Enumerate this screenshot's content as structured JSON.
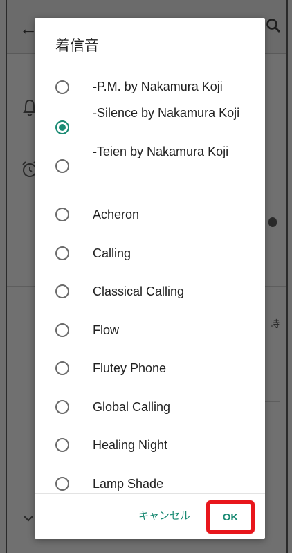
{
  "dialog": {
    "title": "着信音",
    "options": [
      {
        "label": "-P.M. by Nakamura Koji",
        "selected": false
      },
      {
        "label": "-Silence by Nakamura Koji",
        "selected": true
      },
      {
        "label": "-Teien by Nakamura Koji",
        "selected": false
      },
      {
        "label": "Acheron",
        "selected": false
      },
      {
        "label": "Calling",
        "selected": false
      },
      {
        "label": "Classical Calling",
        "selected": false
      },
      {
        "label": "Flow",
        "selected": false
      },
      {
        "label": "Flutey Phone",
        "selected": false
      },
      {
        "label": "Global Calling",
        "selected": false
      },
      {
        "label": "Healing Night",
        "selected": false
      },
      {
        "label": "Lamp Shade",
        "selected": false
      }
    ],
    "cancel_label": "キャンセル",
    "ok_label": "OK"
  },
  "background": {
    "side_text": "時",
    "icons": [
      "back-arrow-icon",
      "search-icon",
      "bell-icon",
      "alarm-icon",
      "chevron-down-icon"
    ]
  },
  "colors": {
    "accent": "#1a8a73",
    "highlight_frame": "#e8161c",
    "scrim": "#707070"
  }
}
